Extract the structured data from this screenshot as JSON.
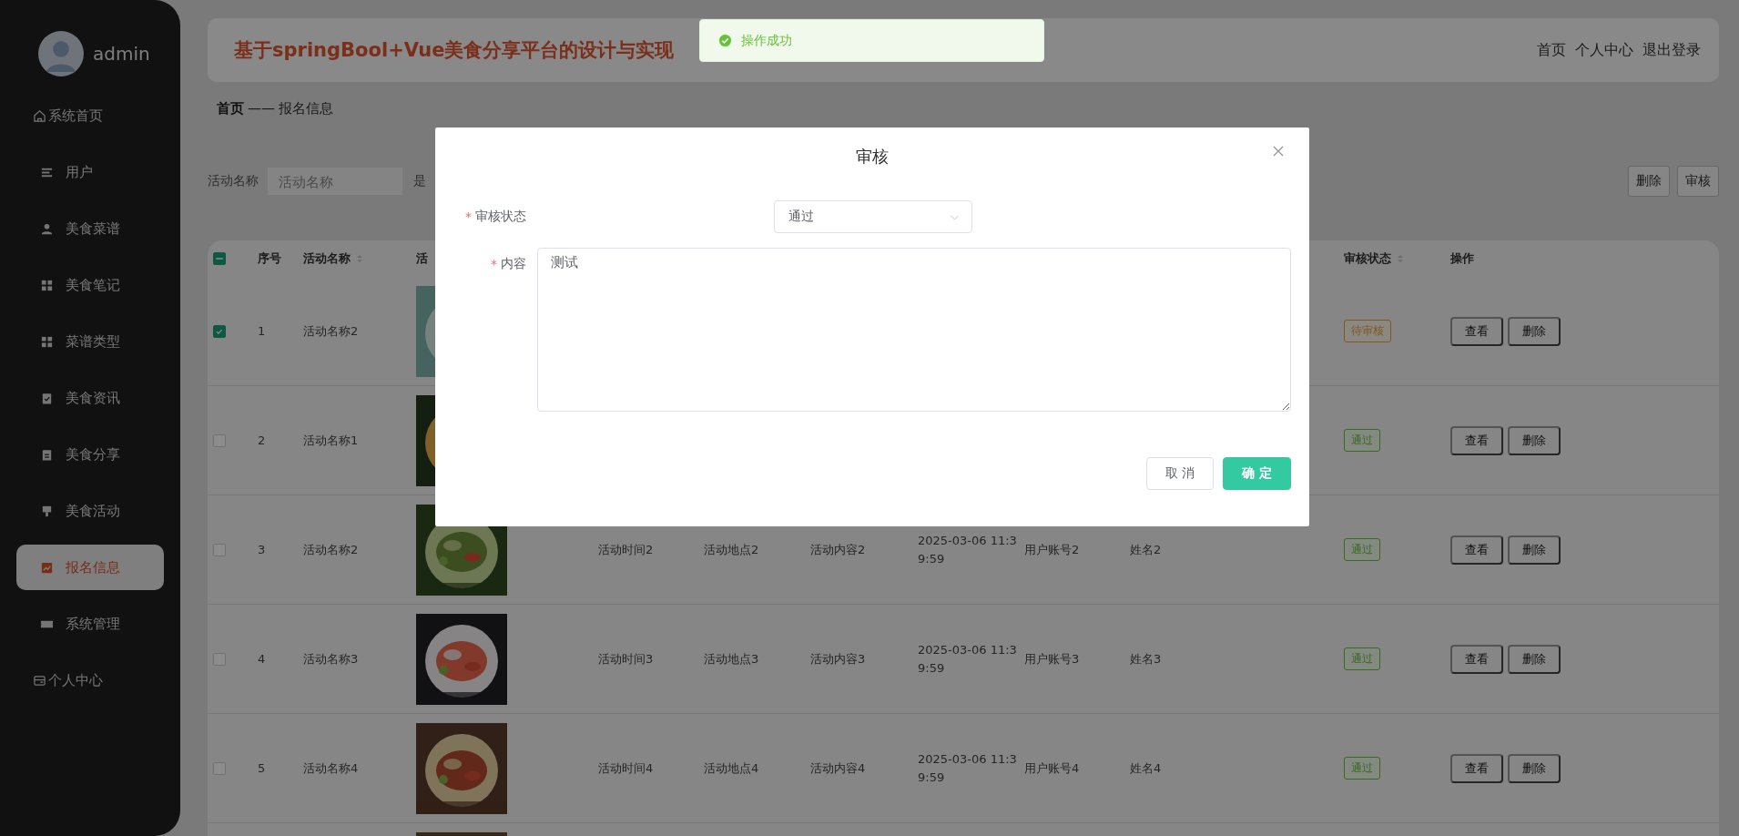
{
  "sidebar": {
    "user": {
      "name": "admin"
    },
    "items": [
      {
        "label": "系统首页",
        "kind": "home",
        "selected": false
      },
      {
        "label": "用户",
        "kind": "lines",
        "selected": false
      },
      {
        "label": "美食菜谱",
        "kind": "person",
        "selected": false
      },
      {
        "label": "美食笔记",
        "kind": "grid",
        "selected": false
      },
      {
        "label": "菜谱类型",
        "kind": "grid",
        "selected": false
      },
      {
        "label": "美食资讯",
        "kind": "check",
        "selected": false
      },
      {
        "label": "美食分享",
        "kind": "clipboard",
        "selected": false
      },
      {
        "label": "美食活动",
        "kind": "brush",
        "selected": false
      },
      {
        "label": "报名信息",
        "kind": "chart",
        "selected": true
      },
      {
        "label": "系统管理",
        "kind": "ticket",
        "selected": false
      },
      {
        "label": "个人中心",
        "kind": "wallet",
        "selected": false
      }
    ]
  },
  "header": {
    "title": "基于springBool+Vue美食分享平台的设计与实现",
    "links": [
      "首页",
      "个人中心",
      "退出登录"
    ]
  },
  "toast": {
    "text": "操作成功"
  },
  "breadcrumb": {
    "home": "首页",
    "separator": "——",
    "current": "报名信息"
  },
  "search": {
    "label": "活动名称",
    "placeholder": "活动名称",
    "label_2": "是"
  },
  "toolbar_buttons": [
    "删除",
    "审核"
  ],
  "table": {
    "select_all": {
      "checked": true,
      "indeterminate": true
    },
    "columns": [
      {
        "label": "序号"
      },
      {
        "label": "活动名称",
        "sortable": true
      },
      {
        "label": "活"
      },
      {
        "label": "审核状态",
        "sortable": true
      },
      {
        "label": "操作"
      }
    ],
    "rows": [
      {
        "checked": true,
        "index": "1",
        "name": "活动名称2",
        "image": {
          "kind": "picture"
        },
        "status": {
          "text": "待审核",
          "kind": "warning"
        },
        "actions": [
          "查看",
          "删除"
        ]
      },
      {
        "checked": false,
        "index": "2",
        "name": "活动名称1",
        "image": {
          "kind": "picture"
        },
        "status": {
          "text": "通过",
          "kind": "success"
        },
        "actions": [
          "查看",
          "删除"
        ]
      },
      {
        "checked": false,
        "index": "3",
        "name": "活动名称2",
        "image": {
          "kind": "picture"
        },
        "time": "活动时间2",
        "place": "活动地点2",
        "content": "活动内容2",
        "date": "2025-03-06 11:39:59",
        "account": "用户账号2",
        "person": "姓名2",
        "status": {
          "text": "通过",
          "kind": "success"
        },
        "actions": [
          "查看",
          "删除"
        ]
      },
      {
        "checked": false,
        "index": "4",
        "name": "活动名称3",
        "image": {
          "kind": "picture"
        },
        "time": "活动时间3",
        "place": "活动地点3",
        "content": "活动内容3",
        "date": "2025-03-06 11:39:59",
        "account": "用户账号3",
        "person": "姓名3",
        "status": {
          "text": "通过",
          "kind": "success"
        },
        "actions": [
          "查看",
          "删除"
        ]
      },
      {
        "checked": false,
        "index": "5",
        "name": "活动名称4",
        "image": {
          "kind": "picture"
        },
        "time": "活动时间4",
        "place": "活动地点4",
        "content": "活动内容4",
        "date": "2025-03-06 11:39:59",
        "account": "用户账号4",
        "person": "姓名4",
        "status": {
          "text": "通过",
          "kind": "success"
        },
        "actions": [
          "查看",
          "删除"
        ]
      },
      {
        "image": {
          "kind": "picture"
        }
      }
    ]
  },
  "dialog": {
    "title": "审核",
    "fields": [
      {
        "label": "审核状态",
        "required_mark": "*",
        "kind": "select",
        "value": "通过"
      },
      {
        "label": "内容",
        "required_mark": "*",
        "kind": "textarea",
        "value": "测试"
      }
    ],
    "buttons": [
      {
        "label": "取 消",
        "kind": "default"
      },
      {
        "label": "确 定",
        "kind": "primary"
      }
    ]
  }
}
